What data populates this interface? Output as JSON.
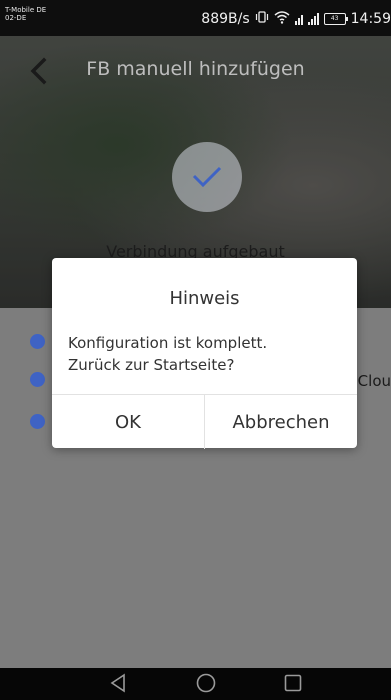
{
  "status_bar": {
    "carrier": "T-Mobile DE\n02-DE",
    "speed": "889B/s",
    "battery": "43",
    "time": "14:59"
  },
  "header": {
    "title": "FB manuell hinzufügen",
    "connection_status": "Verbindung aufgebaut"
  },
  "background_fragment": "Clou",
  "dialog": {
    "title": "Hinweis",
    "message_line1": "Konfiguration ist komplett.",
    "message_line2": "Zurück zur Startseite?",
    "ok_label": "OK",
    "cancel_label": "Abbrechen"
  },
  "icons": {
    "back": "chevron-left-icon",
    "check": "checkmark-icon",
    "vibrate": "vibrate-icon",
    "wifi": "wifi-icon",
    "signal": "signal-icon",
    "battery": "battery-icon",
    "nav_back": "triangle-back-icon",
    "nav_home": "circle-home-icon",
    "nav_recent": "square-recent-icon"
  },
  "colors": {
    "accent": "#3f63c4",
    "dialog_bg": "#ffffff",
    "overlay": "#7d7d7d"
  }
}
